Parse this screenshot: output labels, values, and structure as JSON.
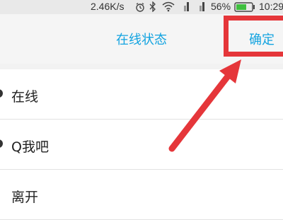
{
  "status_bar": {
    "network_speed": "2.46K/s",
    "alarm_icon": "alarm-icon",
    "bluetooth_icon": "bluetooth-icon",
    "wifi_icon": "wifi-icon",
    "signal_icon": "signal-icon",
    "battery_percent": "56%",
    "time": "10:29"
  },
  "header": {
    "title": "在线状态",
    "confirm_label": "确定",
    "highlight_color": "#e5363a",
    "accent_color": "#12a3e0"
  },
  "status_options": [
    {
      "label": "在线"
    },
    {
      "label": "Q我吧"
    },
    {
      "label": "离开"
    }
  ]
}
